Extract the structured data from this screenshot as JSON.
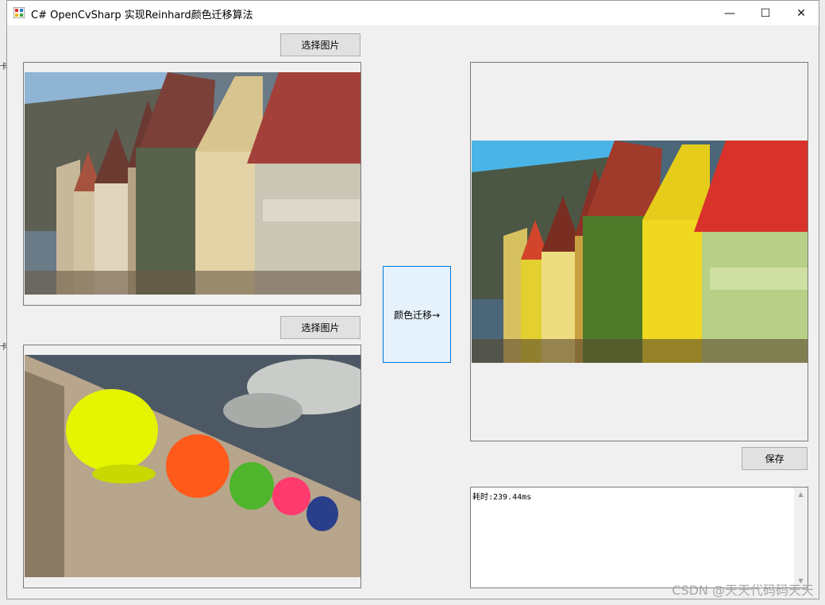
{
  "window": {
    "title": "C# OpenCvSharp 实现Reinhard颜色迁移算法",
    "minimize_glyph": "—",
    "maximize_glyph": "☐",
    "close_glyph": "✕"
  },
  "buttons": {
    "select_image_1": "选择图片",
    "select_image_2": "选择图片",
    "color_transfer": "颜色迁移→",
    "save": "保存"
  },
  "images": {
    "source": "town-houses-photo",
    "target": "colorful-caps-photo",
    "result": "town-houses-recolored-photo"
  },
  "log": {
    "text": "耗时:239.44ms"
  },
  "watermark": "CSDN @天天代码码天天",
  "colors": {
    "accent_border": "#0078d7",
    "accent_fill": "#e5f1fb"
  }
}
